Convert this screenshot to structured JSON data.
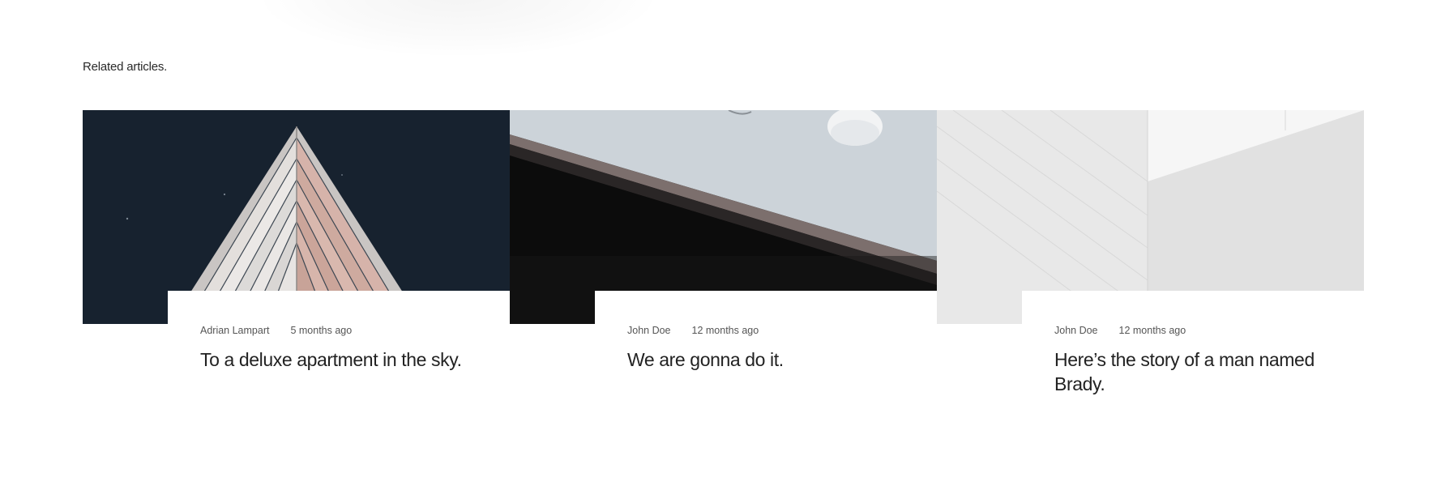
{
  "section": {
    "title": "Related articles."
  },
  "articles": [
    {
      "author": "Adrian Lampart",
      "date": "5 months ago",
      "title": "To a deluxe apartment in the sky.",
      "image": "architecture-triangle-building",
      "colors": {
        "sky": "#17222f",
        "panel": "#dad7d5",
        "accent": "#d6b3aa"
      }
    },
    {
      "author": "John Doe",
      "date": "12 months ago",
      "title": "We are gonna do it.",
      "image": "desk-with-mouse",
      "colors": {
        "desk": "#ccd3d9",
        "shadow": "#0e0e0e",
        "edge": "#7c6f6d"
      }
    },
    {
      "author": "John Doe",
      "date": "12 months ago",
      "title": "Here’s the story of a man named Brady.",
      "image": "white-minimal-architecture",
      "colors": {
        "wall": "#ececec",
        "panel": "#e5e5e5",
        "light": "#f7f7f7"
      }
    }
  ]
}
